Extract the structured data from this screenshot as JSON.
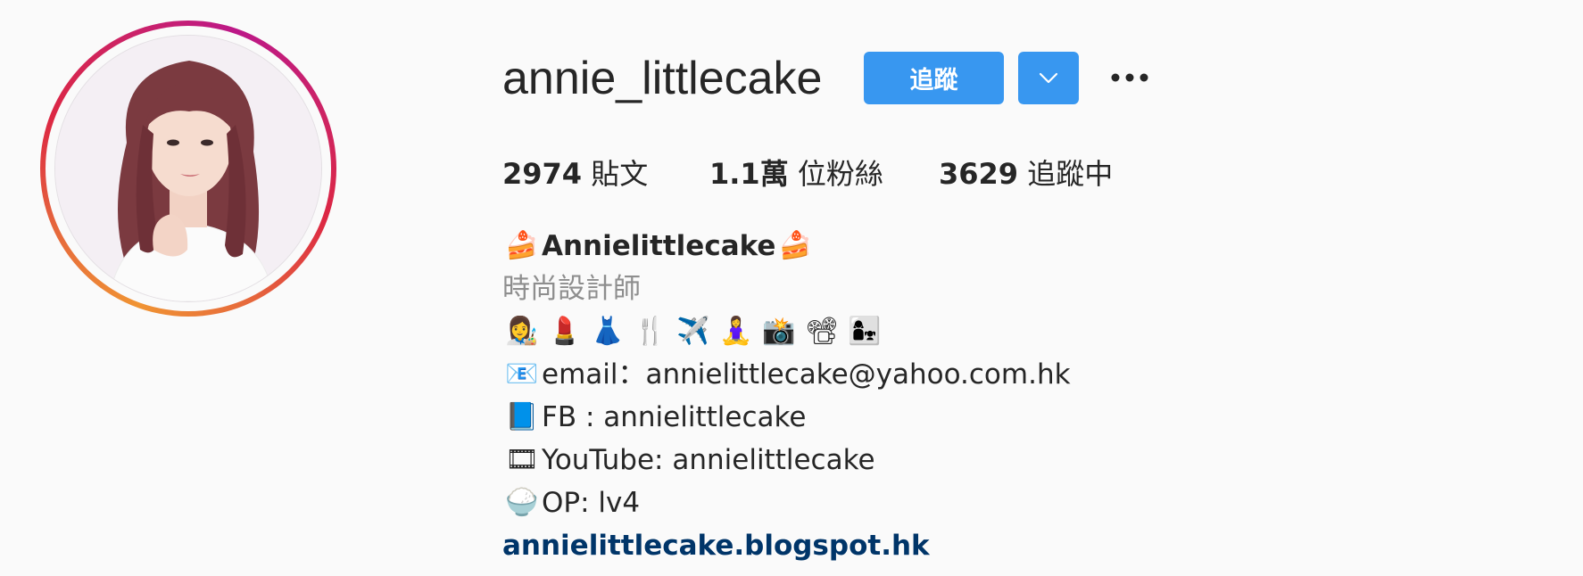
{
  "profile": {
    "username": "annie_littlecake",
    "follow_label": "追蹤",
    "more_icon": "more-horizontal-icon",
    "dropdown_icon": "chevron-down-icon"
  },
  "stats": {
    "posts_count": "2974",
    "posts_label": " 貼文",
    "followers_count": "1.1萬",
    "followers_label": " 位粉絲",
    "following_count": "3629",
    "following_label": " 追蹤中"
  },
  "bio": {
    "name_prefix_emoji": "🍰",
    "name": "Annielittlecake",
    "name_suffix_emoji": "🍰",
    "category": "時尚設計師",
    "emoji_line": [
      "👩‍🎨",
      "💄",
      "👗",
      "🍴",
      "✈️",
      "🧘‍♀️",
      "📸",
      "📽",
      "👩‍👧"
    ],
    "email_emoji": "📧",
    "email_text": "email：annielittlecake@yahoo.com.hk",
    "fb_emoji": "📘",
    "fb_text": "FB : annielittlecake",
    "youtube_emoji": "🎞",
    "youtube_text": "YouTube: annielittlecake",
    "op_emoji": "🍚",
    "op_text": "OP: lv4",
    "website": "annielittlecake.blogspot.hk"
  },
  "colors": {
    "button_blue": "#3897f0",
    "link_navy": "#003569",
    "category_gray": "#8e8e8e"
  }
}
